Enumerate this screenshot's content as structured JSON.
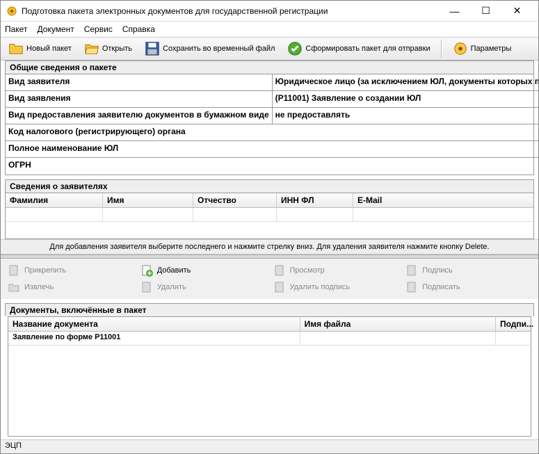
{
  "window": {
    "title": "Подготовка пакета электронных документов для государственной регистрации"
  },
  "menu": {
    "package": "Пакет",
    "document": "Документ",
    "service": "Сервис",
    "help": "Справка"
  },
  "toolbar": {
    "new": "Новый пакет",
    "open": "Открыть",
    "save_temp": "Сохранить во временный файл",
    "form_send": "Сформировать пакет для отправки",
    "params": "Параметры"
  },
  "sections": {
    "general": "Общие сведения о пакете",
    "applicants": "Сведения о заявителях",
    "hint": "Для добавления заявителя выберите последнего и нажмите стрелку вниз. Для удаления заявителя нажмите кнопку Delete.",
    "documents": "Документы, включённые в пакет"
  },
  "form": {
    "rows": [
      {
        "label": "Вид заявителя",
        "value": "Юридическое лицо (за исключением ЮЛ, документы которых пр"
      },
      {
        "label": "Вид заявления",
        "value": "(Р11001) Заявление о создании ЮЛ"
      },
      {
        "label": "Вид предоставления заявителю документов в бумажном виде",
        "value": "не предоставлять"
      },
      {
        "label": "Код налогового (регистрирующего) органа",
        "value": ""
      },
      {
        "label": "Полное наименование ЮЛ",
        "value": ""
      },
      {
        "label": "ОГРН",
        "value": ""
      }
    ]
  },
  "applicants_table": {
    "headers": [
      "Фамилия",
      "Имя",
      "Отчество",
      "ИНН ФЛ",
      "E-Mail"
    ],
    "widths": [
      140,
      130,
      120,
      110,
      250
    ]
  },
  "doc_toolbar": {
    "attach": "Прикрепить",
    "add": "Добавить",
    "view": "Просмотр",
    "sign": "Подпись",
    "extract": "Извлечь",
    "delete": "Удалить",
    "del_sign": "Удалить подпись",
    "signer": "Подписать"
  },
  "documents_table": {
    "headers": [
      "Название документа",
      "Имя файла",
      "Подпи..."
    ],
    "widths": [
      425,
      285,
      50
    ],
    "rows": [
      {
        "name": "Заявление по форме Р11001",
        "file": "",
        "sign": ""
      }
    ]
  },
  "status": {
    "ecp": "ЭЦП"
  }
}
